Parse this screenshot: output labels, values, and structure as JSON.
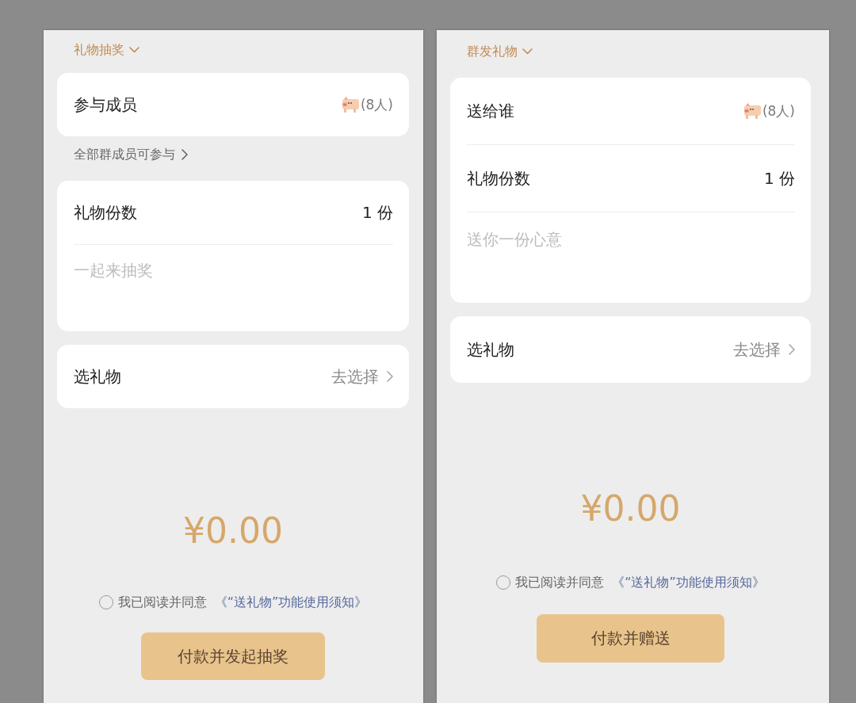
{
  "panels": [
    {
      "mode_selector": "礼物抽奖",
      "sections": [
        {
          "kind": "card",
          "rows": [
            {
              "kind": "members",
              "label": "参与成员",
              "count": "(8人)"
            }
          ]
        },
        {
          "kind": "note",
          "text": "全部群成员可参与"
        },
        {
          "kind": "card",
          "rows": [
            {
              "kind": "value",
              "label": "礼物份数",
              "value": "1 份"
            },
            {
              "kind": "input",
              "placeholder": "一起来抽奖"
            }
          ]
        },
        {
          "kind": "card",
          "rows": [
            {
              "kind": "picker",
              "label": "选礼物",
              "value": "去选择"
            }
          ]
        }
      ],
      "amount": "¥0.00",
      "agreement": {
        "checked": false,
        "text": "我已阅读并同意",
        "link": "《“送礼物”功能使用须知》"
      },
      "submit_button": "付款并发起抽奖"
    },
    {
      "mode_selector": "群发礼物",
      "sections": [
        {
          "kind": "card",
          "rows": [
            {
              "kind": "members",
              "label": "送给谁",
              "count": "(8人)"
            },
            {
              "kind": "value",
              "label": "礼物份数",
              "value": "1 份"
            },
            {
              "kind": "input",
              "placeholder": "送你一份心意"
            }
          ]
        },
        {
          "kind": "card",
          "rows": [
            {
              "kind": "picker",
              "label": "选礼物",
              "value": "去选择"
            }
          ]
        }
      ],
      "amount": "¥0.00",
      "agreement": {
        "checked": false,
        "text": "我已阅读并同意",
        "link": "《“送礼物”功能使用须知》"
      },
      "submit_button": "付款并赠送"
    }
  ]
}
